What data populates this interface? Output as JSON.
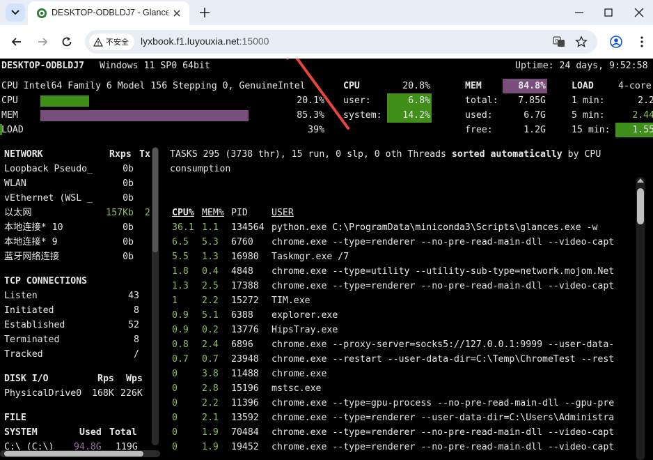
{
  "browser": {
    "tab_title": "DESKTOP-ODBLDJ7 - Glances",
    "security_label": "不安全",
    "url_host": "lyxbook.f1.luyouxia.net",
    "url_port": ":15000"
  },
  "header": {
    "hostname": "DESKTOP-ODBLDJ7",
    "os": "Windows 11 SP0 64bit",
    "uptime": "Uptime: 24 days, 9:52:58"
  },
  "quicklook": {
    "cpu_name": "CPU Intel64 Family 6 Model 156 Stepping 0, GenuineIntel",
    "rows": [
      {
        "label": "CPU",
        "value": "20.1%",
        "fraction": 0.201
      },
      {
        "label": "MEM",
        "value": "85.3%",
        "fraction": 0.853
      },
      {
        "label": "LOAD",
        "value": "39%",
        "fraction": 0.39
      }
    ]
  },
  "cpu": {
    "title": "CPU",
    "total": "20.8%",
    "rows": [
      {
        "label": "user:",
        "value": "6.8%"
      },
      {
        "label": "system:",
        "value": "14.2%"
      }
    ]
  },
  "mem": {
    "title": "MEM",
    "total": "84.8%",
    "rows": [
      {
        "label": "total:",
        "value": "7.85G"
      },
      {
        "label": "used:",
        "value": "6.7G"
      },
      {
        "label": "free:",
        "value": "1.2G"
      }
    ]
  },
  "load": {
    "title": "LOAD",
    "cores": "4-core",
    "rows": [
      {
        "label": "1 min:",
        "value": "2.2"
      },
      {
        "label": "5 min:",
        "value": "2.44"
      },
      {
        "label": "15 min:",
        "value": "1.55"
      }
    ]
  },
  "network": {
    "title": "NETWORK",
    "col_rx": "Rxps",
    "col_tx": "Tx",
    "rows": [
      {
        "name": "Loopback Pseudo_",
        "rx": "0b",
        "tx": ""
      },
      {
        "name": "WLAN",
        "rx": "0b",
        "tx": ""
      },
      {
        "name": "vEthernet (WSL _",
        "rx": "0b",
        "tx": ""
      },
      {
        "name": "以太网",
        "rx": "157Kb",
        "tx": "2"
      },
      {
        "name": "本地连接* 10",
        "rx": "0b",
        "tx": ""
      },
      {
        "name": "本地连接* 9",
        "rx": "0b",
        "tx": ""
      },
      {
        "name": "蓝牙网络连接",
        "rx": "0b",
        "tx": ""
      }
    ]
  },
  "tcp": {
    "title": "TCP CONNECTIONS",
    "rows": [
      {
        "label": "Listen",
        "value": "43"
      },
      {
        "label": "Initiated",
        "value": "8"
      },
      {
        "label": "Established",
        "value": "52"
      },
      {
        "label": "Terminated",
        "value": "8"
      },
      {
        "label": "Tracked",
        "value": "/"
      }
    ]
  },
  "disk": {
    "title": "DISK I/O",
    "col_r": "Rps",
    "col_w": "Wps",
    "rows": [
      {
        "name": "PhysicalDrive0",
        "r": "168K",
        "w": "226K"
      }
    ]
  },
  "fs": {
    "title": "FILE",
    "title2": "SYSTEM",
    "col_used": "Used",
    "col_total": "Total",
    "rows": [
      {
        "name": "C:\\ (C:\\)",
        "used": "94.8G",
        "total": "119G"
      }
    ]
  },
  "tasks": {
    "summary_pre": "TASKS 295 (3738 thr), 15 run, 0 slp, 0 oth Threads ",
    "sorted": "sorted",
    "automatically": "automatically",
    "summary_post": " by CPU",
    "summary_line2": "consumption"
  },
  "processes": {
    "columns": {
      "cpu": "CPU%",
      "mem": "MEM%",
      "pid": "PID",
      "user": "USER"
    },
    "rows": [
      {
        "cpu": "36.1",
        "mem": "1.1",
        "pid": "134564",
        "cmd": "python.exe C:\\ProgramData\\miniconda3\\Scripts\\glances.exe -w"
      },
      {
        "cpu": "6.5",
        "mem": "5.3",
        "pid": "6760",
        "cmd": "chrome.exe --type=renderer --no-pre-read-main-dll --video-capt"
      },
      {
        "cpu": "5.5",
        "mem": "1.3",
        "pid": "16980",
        "cmd": "Taskmgr.exe /7"
      },
      {
        "cpu": "1.8",
        "mem": "0.4",
        "pid": "4848",
        "cmd": "chrome.exe --type=utility --utility-sub-type=network.mojom.Net"
      },
      {
        "cpu": "1.3",
        "mem": "2.5",
        "pid": "17388",
        "cmd": "chrome.exe --type=renderer --no-pre-read-main-dll --video-capt"
      },
      {
        "cpu": "1",
        "mem": "2.2",
        "pid": "15272",
        "cmd": "TIM.exe"
      },
      {
        "cpu": "0.9",
        "mem": "5.1",
        "pid": "6388",
        "cmd": "explorer.exe"
      },
      {
        "cpu": "0.9",
        "mem": "0.2",
        "pid": "13776",
        "cmd": "HipsTray.exe"
      },
      {
        "cpu": "0.8",
        "mem": "2.4",
        "pid": "6896",
        "cmd": "chrome.exe --proxy-server=socks5://127.0.0.1:9999 --user-data-"
      },
      {
        "cpu": "0.7",
        "mem": "0.7",
        "pid": "23948",
        "cmd": "chrome.exe --restart --user-data-dir=C:\\Temp\\ChromeTest --rest"
      },
      {
        "cpu": "0",
        "mem": "3.8",
        "pid": "11488",
        "cmd": "chrome.exe"
      },
      {
        "cpu": "0",
        "mem": "2.8",
        "pid": "15196",
        "cmd": "mstsc.exe"
      },
      {
        "cpu": "0",
        "mem": "2.2",
        "pid": "11396",
        "cmd": "chrome.exe --type=gpu-process --no-pre-read-main-dll --gpu-pre"
      },
      {
        "cpu": "0",
        "mem": "2.1",
        "pid": "13592",
        "cmd": "chrome.exe --type=renderer --user-data-dir=C:\\Users\\Administra"
      },
      {
        "cpu": "0",
        "mem": "1.9",
        "pid": "70484",
        "cmd": "chrome.exe --type=renderer --no-pre-read-main-dll --video-capt"
      },
      {
        "cpu": "0",
        "mem": "1.9",
        "pid": "19452",
        "cmd": "chrome.exe --type=renderer --no-pre-read-main-dll --video-capt"
      }
    ]
  },
  "colors": {
    "accent_green": "#3f8f1a",
    "accent_purple": "#7a4e7a",
    "annotation_arrow": "#e8453c"
  }
}
